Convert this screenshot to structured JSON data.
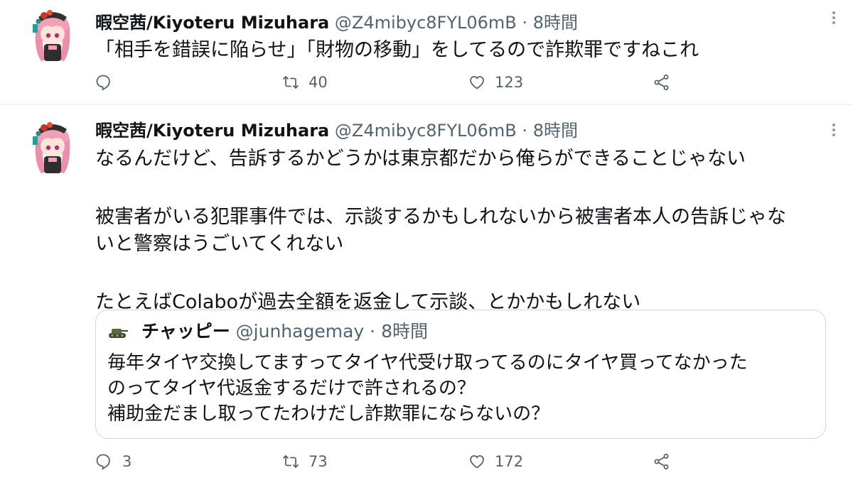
{
  "tweets": [
    {
      "author": {
        "name": "暇空茜/Kiyoteru Mizuhara",
        "handle": "@Z4mibyc8FYL06mB"
      },
      "separator": "·",
      "time": "8時間",
      "text": [
        "「相手を錯誤に陥らせ」「財物の移動」をしてるので詐欺罪ですねこれ"
      ],
      "actions": {
        "replies": "",
        "retweets": "40",
        "likes": "123"
      }
    },
    {
      "author": {
        "name": "暇空茜/Kiyoteru Mizuhara",
        "handle": "@Z4mibyc8FYL06mB"
      },
      "separator": "·",
      "time": "8時間",
      "text": [
        "なるんだけど、告訴するかどうかは東京都だから俺らができることじゃない",
        "被害者がいる犯罪事件では、示談するかもしれないから被害者本人の告訴じゃな",
        "いと警察はうごいてくれない",
        "たとえばColaboが過去全額を返金して示談、とかかもしれない"
      ],
      "quote": {
        "author": {
          "name": "チャッピー",
          "handle": "@junhagemay"
        },
        "separator": "·",
        "time": "8時間",
        "text": [
          "毎年タイヤ交換してますってタイヤ代受け取ってるのにタイヤ買ってなかった",
          "のってタイヤ代返金するだけで許されるの？",
          "補助金だまし取ってたわけだし詐欺罪にならないの？"
        ]
      },
      "actions": {
        "replies": "3",
        "retweets": "73",
        "likes": "172"
      }
    }
  ],
  "icons": [
    "avatar",
    "more-icon",
    "reply-icon",
    "retweet-icon",
    "like-icon",
    "share-icon",
    "tank-avatar"
  ],
  "colors": {
    "text": "#0f1419",
    "secondary": "#536471",
    "border": "#cfd9de",
    "divider": "#eff3f4"
  }
}
